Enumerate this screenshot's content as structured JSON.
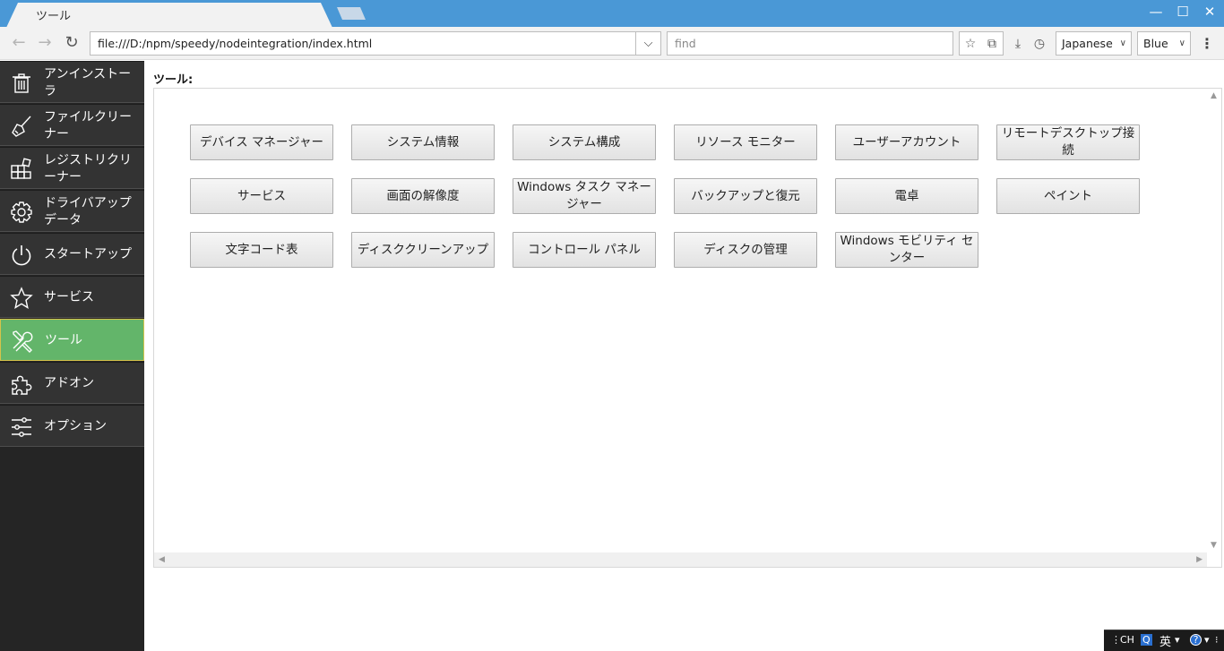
{
  "window": {
    "tab_title": "ツール",
    "minimize": "—",
    "maximize": "☐",
    "close": "✕"
  },
  "toolbar": {
    "back_icon": "arrow-left-icon",
    "forward_icon": "arrow-right-icon",
    "reload_icon": "reload-icon",
    "url": "file:///D:/npm/speedy/nodeintegration/index.html",
    "find_placeholder": "find",
    "language": "Japanese",
    "theme": "Blue"
  },
  "sidebar": {
    "items": [
      {
        "label": "アンインストーラ",
        "icon": "trash-icon"
      },
      {
        "label": "ファイルクリーナー",
        "icon": "broom-icon"
      },
      {
        "label": "レジストリクリーナー",
        "icon": "registry-blocks-icon"
      },
      {
        "label": "ドライバアップデータ",
        "icon": "gear-icon"
      },
      {
        "label": "スタートアップ",
        "icon": "power-icon"
      },
      {
        "label": "サービス",
        "icon": "star-icon"
      },
      {
        "label": "ツール",
        "icon": "tools-icon"
      },
      {
        "label": "アドオン",
        "icon": "puzzle-icon"
      },
      {
        "label": "オプション",
        "icon": "sliders-icon"
      }
    ]
  },
  "main": {
    "heading": "ツール:",
    "tools": [
      "デバイス マネージャー",
      "システム情報",
      "システム構成",
      "リソース モニター",
      "ユーザーアカウント",
      "リモートデスクトップ接続",
      "サービス",
      "画面の解像度",
      "Windows タスク マネージャー",
      "バックアップと復元",
      "電卓",
      "ペイント",
      "文字コード表",
      "ディスククリーンアップ",
      "コントロール パネル",
      "ディスクの管理",
      "Windows モビリティ センター"
    ]
  },
  "tray": {
    "ime": "CH",
    "mode": "英",
    "help": "?"
  }
}
